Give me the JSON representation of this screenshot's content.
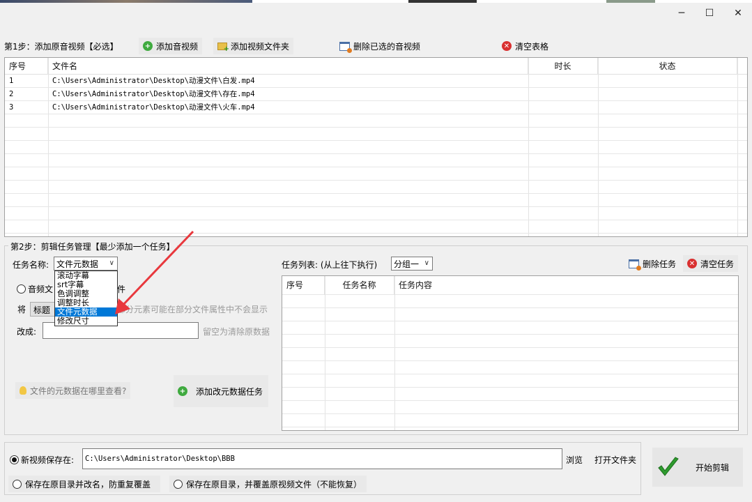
{
  "window": {
    "minimize_glyph": "─",
    "maximize_glyph": "☐",
    "close_glyph": "✕"
  },
  "step1": {
    "label": "第1步：添加原音视频【必选】",
    "add_media": "添加音视频",
    "add_folder": "添加视频文件夹",
    "delete_selected": "删除已选的音视频",
    "clear_table": "清空表格",
    "columns": [
      "序号",
      "文件名",
      "时长",
      "状态"
    ],
    "rows": [
      {
        "index": "1",
        "filename": "C:\\Users\\Administrator\\Desktop\\动漫文件\\白发.mp4",
        "duration": "",
        "status": ""
      },
      {
        "index": "2",
        "filename": "C:\\Users\\Administrator\\Desktop\\动漫文件\\存在.mp4",
        "duration": "",
        "status": ""
      },
      {
        "index": "3",
        "filename": "C:\\Users\\Administrator\\Desktop\\动漫文件\\火车.mp4",
        "duration": "",
        "status": ""
      }
    ]
  },
  "step2": {
    "label": "第2步：剪辑任务管理【最少添加一个任务】",
    "task_name_label": "任务名称:",
    "task_name_value": "文件元数据",
    "dropdown_options": [
      "滚动字幕",
      "srt字幕",
      "色调调整",
      "调整时长",
      "文件元数据",
      "修改尺寸"
    ],
    "radio_audio_prefix": "音频文",
    "radio_audio_suffix": "件",
    "replace_label": "将",
    "field_select": "标题",
    "hint_display": "部分元素可能在部分文件属性中不会显示",
    "change_to_label": "改成:",
    "change_to_value": "",
    "hint_clear": "留空为清除原数据",
    "where_metadata": "文件的元数据在哪里查看?",
    "add_task": "添加改元数据任务",
    "task_list_label": "任务列表: (从上往下执行)",
    "group_select": "分组一",
    "delete_task": "删除任务",
    "clear_tasks": "清空任务",
    "task_columns": [
      "序号",
      "任务名称",
      "任务内容"
    ]
  },
  "save": {
    "new_save_label": "新视频保存在:",
    "path": "C:\\Users\\Administrator\\Desktop\\BBB",
    "browse": "浏览",
    "open_folder": "打开文件夹",
    "option_rename": "保存在原目录并改名，防重复覆盖",
    "option_overwrite": "保存在原目录，并覆盖原视频文件（不能恢复）",
    "start": "开始剪辑"
  },
  "colors": {
    "accent": "#0078d7",
    "arrow": "#e8383d",
    "start_check": "#2e9b2e"
  }
}
